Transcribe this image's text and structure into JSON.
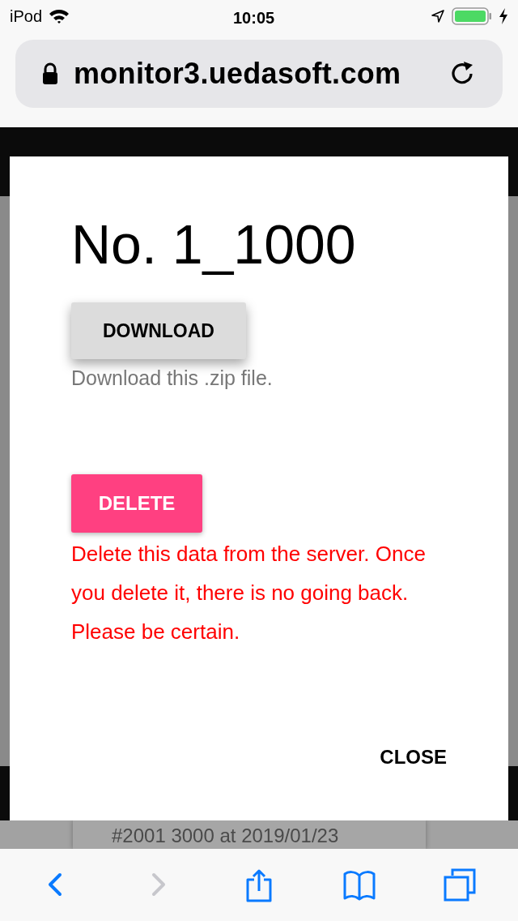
{
  "status_bar": {
    "device": "iPod",
    "time": "10:05"
  },
  "address_bar": {
    "url": "monitor3.uedasoft.com"
  },
  "background_list": {
    "item_text": "#2001 3000 at 2019/01/23"
  },
  "dialog": {
    "title": "No. 1_1000",
    "download_button": "DOWNLOAD",
    "download_note": "Download this .zip file.",
    "delete_button": "DELETE",
    "delete_warning": "Delete this data from the server. Once you delete it, there is no going back. Please be certain.",
    "close_button": "CLOSE"
  },
  "toolbar": [
    {
      "kind": "back",
      "disabled": false
    },
    {
      "kind": "forward",
      "disabled": true
    },
    {
      "kind": "share",
      "disabled": false
    },
    {
      "kind": "bookmarks",
      "disabled": false
    },
    {
      "kind": "tabs",
      "disabled": false
    }
  ]
}
